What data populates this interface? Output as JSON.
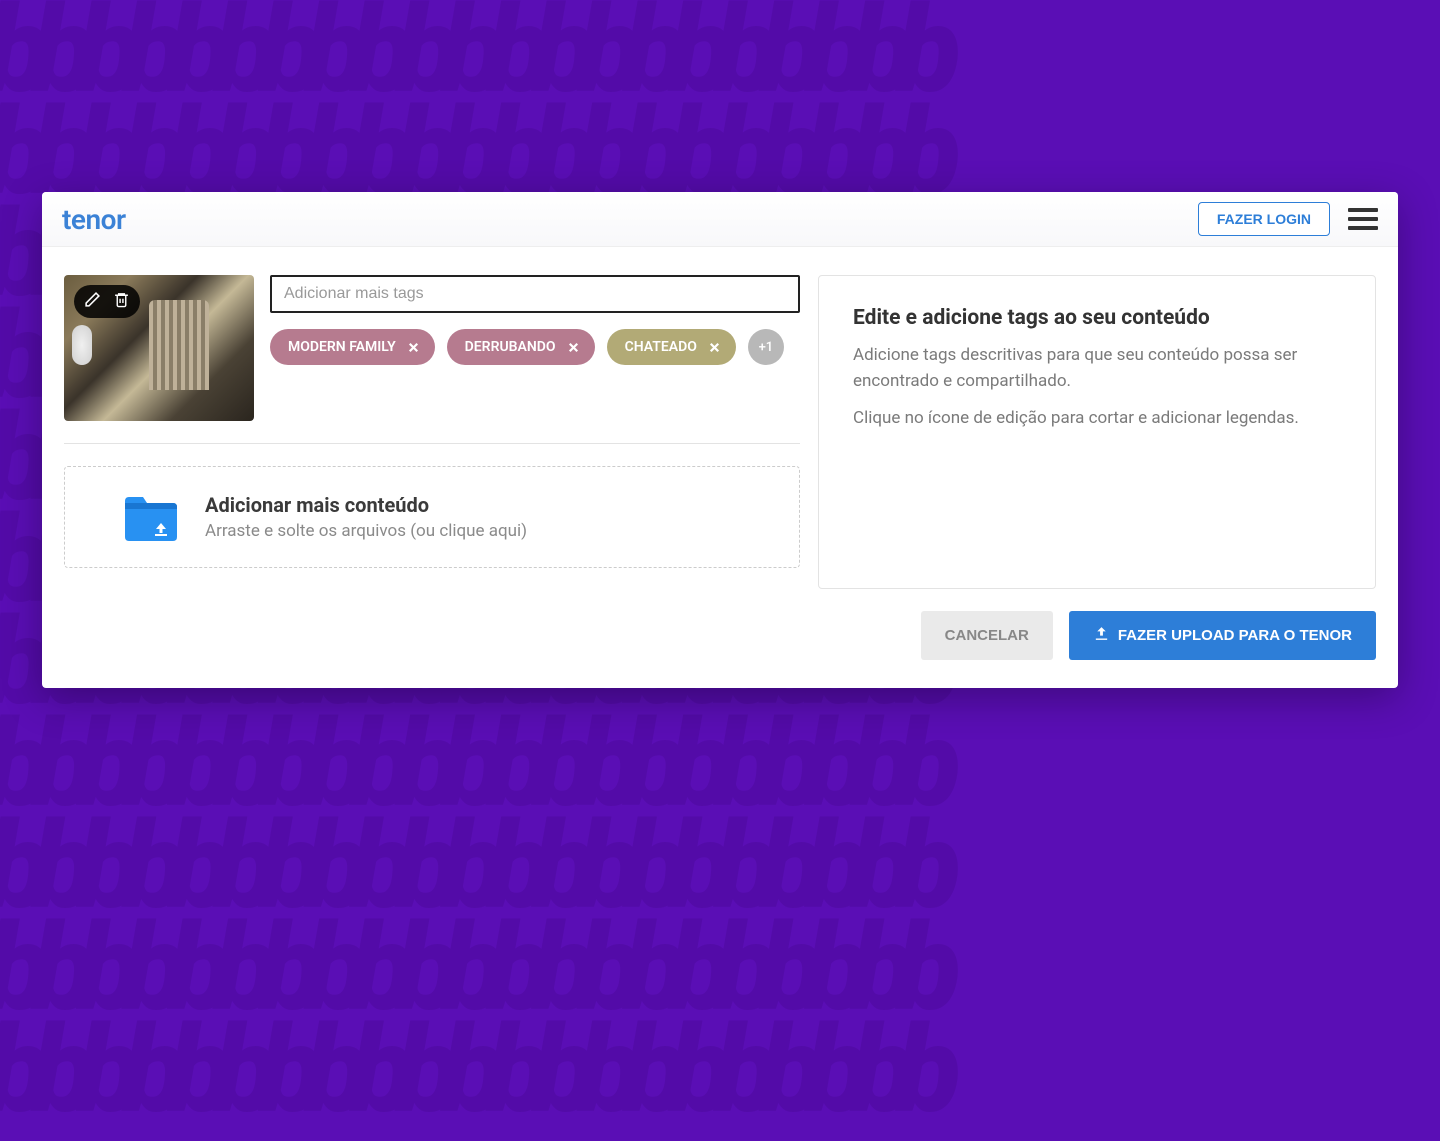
{
  "header": {
    "logo": "tenor",
    "login_label": "FAZER LOGIN"
  },
  "tag_input": {
    "placeholder": "Adicionar mais tags"
  },
  "tags": [
    {
      "label": "MODERN FAMILY",
      "style": "purple"
    },
    {
      "label": "DERRUBANDO",
      "style": "purple"
    },
    {
      "label": "CHATEADO",
      "style": "olive"
    }
  ],
  "tags_overflow": "+1",
  "dropzone": {
    "title": "Adicionar mais conteúdo",
    "subtitle": "Arraste e solte os arquivos (ou clique aqui)"
  },
  "info": {
    "title": "Edite e adicione tags ao seu conteúdo",
    "p1": "Adicione tags descritivas para que seu conteúdo possa ser encontrado e compartilhado.",
    "p2": "Clique no ícone de edição para cortar e adicionar legendas."
  },
  "actions": {
    "cancel": "CANCELAR",
    "upload": "FAZER UPLOAD PARA O TENOR"
  }
}
